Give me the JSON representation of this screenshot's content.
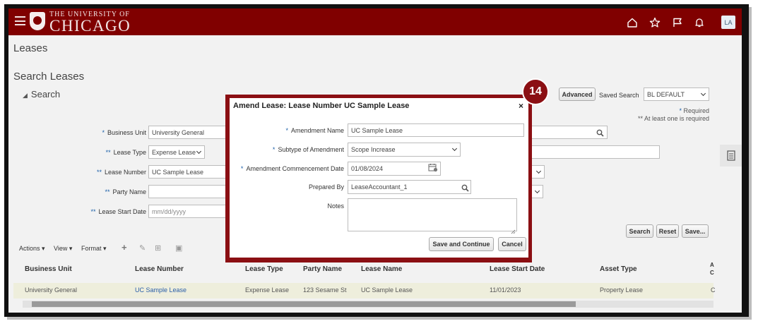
{
  "header": {
    "logo_small": "THE UNIVERSITY OF",
    "logo_big": "CHICAGO",
    "avatar": "LA"
  },
  "page": {
    "title": "Leases",
    "search_title": "Search Leases",
    "search_section": "Search"
  },
  "search_form": {
    "business_unit": {
      "label": "Business Unit",
      "value": "University General",
      "required": "*"
    },
    "lease_type": {
      "label": "Lease Type",
      "value": "Expense Lease",
      "required": "**"
    },
    "lease_number": {
      "label": "Lease Number",
      "value": "UC Sample Lease",
      "required": "**"
    },
    "party_name": {
      "label": "Party Name",
      "value": "",
      "required": "**"
    },
    "lease_start_date": {
      "label": "Lease Start Date",
      "placeholder": "mm/dd/yyyy",
      "required": "**"
    },
    "advanced_label": "Advanced",
    "saved_search_label": "Saved Search",
    "saved_search_value": "BL DEFAULT",
    "required_note": "Required",
    "required_star": "*",
    "at_least_one_note": "** At least one is required",
    "search_button": "Search",
    "reset_button": "Reset",
    "save_button": "Save..."
  },
  "toolbar": {
    "actions": "Actions",
    "view": "View",
    "format": "Format"
  },
  "table": {
    "columns": [
      "Business Unit",
      "Lease Number",
      "Lease Type",
      "Party Name",
      "Lease Name",
      "Lease Start Date",
      "Asset Type",
      "A",
      "C"
    ],
    "rows": [
      [
        "University General",
        "UC Sample Lease",
        "Expense Lease",
        "123 Sesame St",
        "UC Sample Lease",
        "11/01/2023",
        "Property Lease",
        "C"
      ]
    ]
  },
  "dialog": {
    "title": "Amend Lease: Lease Number UC Sample Lease",
    "close": "×",
    "amendment_name": {
      "label": "Amendment Name",
      "value": "UC Sample Lease",
      "required": "*"
    },
    "subtype": {
      "label": "Subtype of Amendment",
      "value": "Scope Increase",
      "required": "*"
    },
    "commencement_date": {
      "label": "Amendment Commencement Date",
      "value": "01/08/2024",
      "required": "*"
    },
    "prepared_by": {
      "label": "Prepared By",
      "value": "LeaseAccountant_1"
    },
    "notes": {
      "label": "Notes",
      "value": ""
    },
    "save_continue": "Save and Continue",
    "cancel": "Cancel"
  },
  "step_badge": "14",
  "colors": {
    "brand_maroon": "#800000",
    "callout_red": "#8b0f13",
    "link_blue": "#2a5ea8",
    "row_highlight": "#eeeedc"
  }
}
